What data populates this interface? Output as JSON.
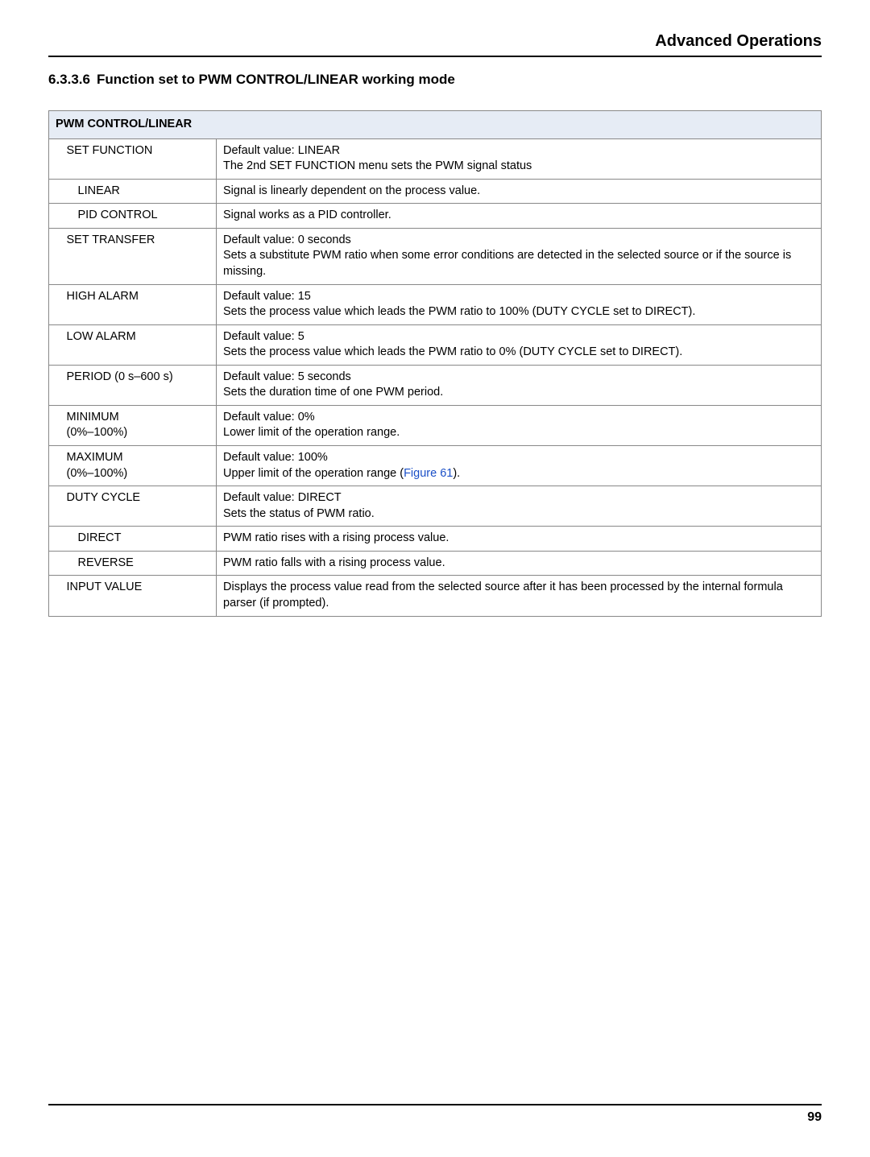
{
  "header": {
    "title": "Advanced Operations"
  },
  "section": {
    "number": "6.3.3.6",
    "title": "Function set to PWM CONTROL/LINEAR working mode"
  },
  "table": {
    "title": "PWM CONTROL/LINEAR",
    "rows": {
      "set_function": {
        "label": "SET FUNCTION",
        "desc_l1": "Default value: LINEAR",
        "desc_l2": "The 2nd SET FUNCTION menu sets the PWM signal status"
      },
      "linear": {
        "label": "LINEAR",
        "desc": "Signal is linearly dependent on the process value."
      },
      "pid": {
        "label": "PID CONTROL",
        "desc": "Signal works as a PID controller."
      },
      "set_transfer": {
        "label": "SET TRANSFER",
        "desc_l1": "Default value: 0 seconds",
        "desc_l2": "Sets a substitute PWM ratio when some error conditions are detected in the selected source or if the source is missing."
      },
      "high_alarm": {
        "label": "HIGH ALARM",
        "desc_l1": "Default value: 15",
        "desc_l2": "Sets the process value which leads the PWM ratio to 100% (DUTY CYCLE set to DIRECT)."
      },
      "low_alarm": {
        "label": "LOW ALARM",
        "desc_l1": "Default value: 5",
        "desc_l2": "Sets the process value which leads the PWM ratio to 0% (DUTY CYCLE set to DIRECT)."
      },
      "period": {
        "label": "PERIOD (0 s–600 s)",
        "desc_l1": "Default value: 5 seconds",
        "desc_l2": "Sets the duration time of one PWM period."
      },
      "minimum": {
        "label_l1": "MINIMUM",
        "label_l2": "(0%–100%)",
        "desc_l1": "Default value: 0%",
        "desc_l2": "Lower limit of the operation range."
      },
      "maximum": {
        "label_l1": "MAXIMUM",
        "label_l2": "(0%–100%)",
        "desc_l1": "Default value: 100%",
        "desc_pre": "Upper limit of the operation range (",
        "desc_link": "Figure 61",
        "desc_post": ")."
      },
      "duty_cycle": {
        "label": "DUTY CYCLE",
        "desc_l1": "Default value: DIRECT",
        "desc_l2": "Sets the status of PWM ratio."
      },
      "direct": {
        "label": "DIRECT",
        "desc": "PWM ratio rises with a rising process value."
      },
      "reverse": {
        "label": "REVERSE",
        "desc": "PWM ratio falls with a rising process value."
      },
      "input_value": {
        "label": "INPUT VALUE",
        "desc": "Displays the process value read from the selected source after it has been processed by the internal formula parser (if prompted)."
      }
    }
  },
  "footer": {
    "page": "99"
  }
}
